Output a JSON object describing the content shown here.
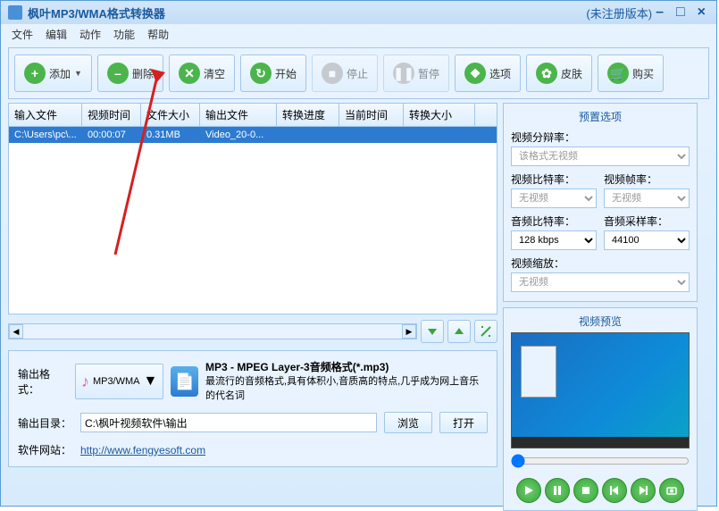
{
  "title": "枫叶MP3/WMA格式转换器",
  "version_note": "(未注册版本)",
  "menus": [
    "文件",
    "编辑",
    "动作",
    "功能",
    "帮助"
  ],
  "toolbar": {
    "add": "添加",
    "delete": "删除",
    "clear": "清空",
    "start": "开始",
    "stop": "停止",
    "pause": "暂停",
    "options": "选项",
    "skin": "皮肤",
    "buy": "购买"
  },
  "table": {
    "headers": [
      "输入文件",
      "视频时间",
      "文件大小",
      "输出文件",
      "转换进度",
      "当前时间",
      "转换大小"
    ],
    "rows": [
      {
        "input": "C:\\Users\\pc\\...",
        "time": "00:00:07",
        "size": "0.31MB",
        "output": "Video_20-0...",
        "progress": "",
        "cur_time": "",
        "conv_size": ""
      }
    ]
  },
  "output": {
    "format_label": "输出格式：",
    "format_value": "MP3/WMA",
    "desc_title": "MP3 - MPEG Layer-3音频格式(*.mp3)",
    "desc_body": "最流行的音频格式,具有体积小,音质高的特点,几乎成为网上音乐的代名词",
    "dir_label": "输出目录：",
    "dir_value": "C:\\枫叶视频软件\\输出",
    "browse": "浏览",
    "open": "打开",
    "site_label": "软件网站：",
    "site_url": "http://www.fengyesoft.com"
  },
  "preset": {
    "title": "预置选项",
    "res_label": "视频分辩率：",
    "res_value": "该格式无视频",
    "vbr_label": "视频比特率：",
    "vbr_value": "无视频",
    "fps_label": "视频帧率：",
    "fps_value": "无视频",
    "abr_label": "音频比特率：",
    "abr_value": "128 kbps",
    "asr_label": "音频采样率：",
    "asr_value": "44100",
    "zoom_label": "视频缩放：",
    "zoom_value": "无视频"
  },
  "preview": {
    "title": "视频预览"
  }
}
